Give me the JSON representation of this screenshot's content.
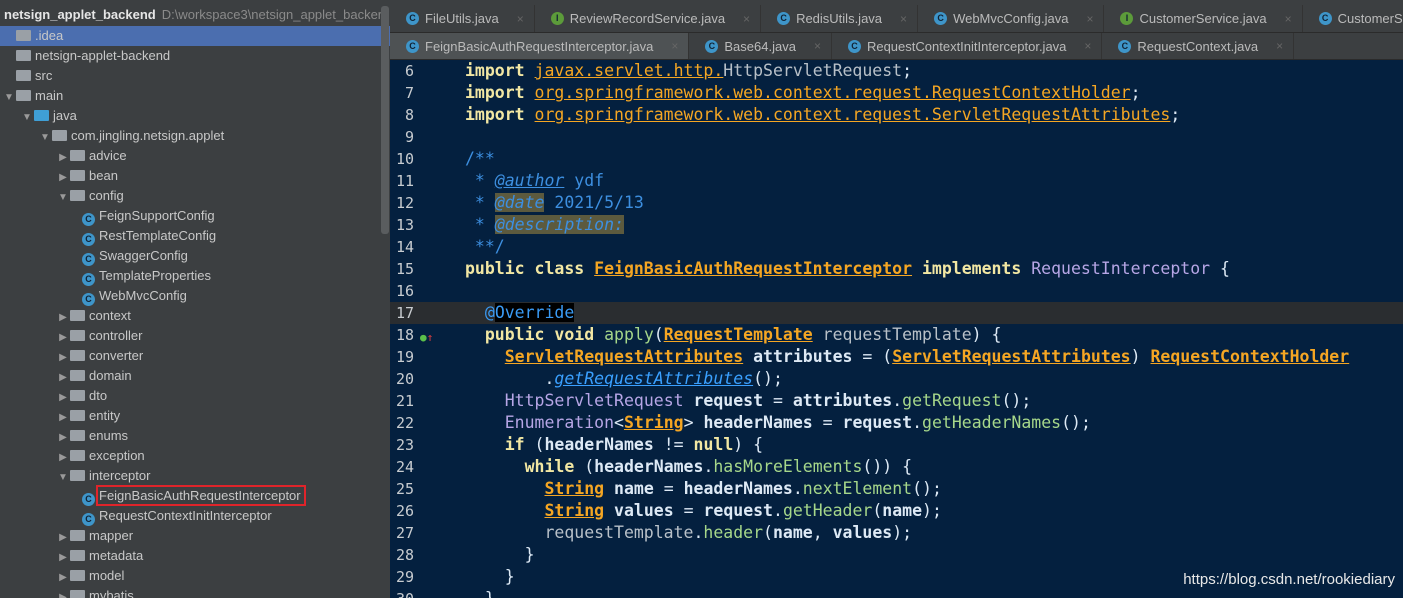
{
  "project": {
    "name": "netsign_applet_backend",
    "path": "D:\\workspace3\\netsign_applet_backer"
  },
  "tree": [
    {
      "label": ".idea",
      "level": 0,
      "kind": "folder",
      "selected": true
    },
    {
      "label": "netsign-applet-backend",
      "level": 0,
      "kind": "folder"
    },
    {
      "label": "src",
      "level": 0,
      "kind": "folder"
    },
    {
      "label": "main",
      "level": 0,
      "kind": "folder",
      "expand": "open"
    },
    {
      "label": "java",
      "level": 1,
      "kind": "src",
      "expand": "open"
    },
    {
      "label": "com.jingling.netsign.applet",
      "level": 2,
      "kind": "folder",
      "expand": "open"
    },
    {
      "label": "advice",
      "level": 3,
      "kind": "folder",
      "expand": "closed"
    },
    {
      "label": "bean",
      "level": 3,
      "kind": "folder",
      "expand": "closed"
    },
    {
      "label": "config",
      "level": 3,
      "kind": "folder",
      "expand": "open"
    },
    {
      "label": "FeignSupportConfig",
      "level": 4,
      "kind": "class"
    },
    {
      "label": "RestTemplateConfig",
      "level": 4,
      "kind": "class"
    },
    {
      "label": "SwaggerConfig",
      "level": 4,
      "kind": "class"
    },
    {
      "label": "TemplateProperties",
      "level": 4,
      "kind": "class"
    },
    {
      "label": "WebMvcConfig",
      "level": 4,
      "kind": "class"
    },
    {
      "label": "context",
      "level": 3,
      "kind": "folder",
      "expand": "closed"
    },
    {
      "label": "controller",
      "level": 3,
      "kind": "folder",
      "expand": "closed"
    },
    {
      "label": "converter",
      "level": 3,
      "kind": "folder",
      "expand": "closed"
    },
    {
      "label": "domain",
      "level": 3,
      "kind": "folder",
      "expand": "closed"
    },
    {
      "label": "dto",
      "level": 3,
      "kind": "folder",
      "expand": "closed"
    },
    {
      "label": "entity",
      "level": 3,
      "kind": "folder",
      "expand": "closed"
    },
    {
      "label": "enums",
      "level": 3,
      "kind": "folder",
      "expand": "closed"
    },
    {
      "label": "exception",
      "level": 3,
      "kind": "folder",
      "expand": "closed"
    },
    {
      "label": "interceptor",
      "level": 3,
      "kind": "folder",
      "expand": "open"
    },
    {
      "label": "FeignBasicAuthRequestInterceptor",
      "level": 4,
      "kind": "class",
      "highlighted": true
    },
    {
      "label": "RequestContextInitInterceptor",
      "level": 4,
      "kind": "class"
    },
    {
      "label": "mapper",
      "level": 3,
      "kind": "folder",
      "expand": "closed"
    },
    {
      "label": "metadata",
      "level": 3,
      "kind": "folder",
      "expand": "closed"
    },
    {
      "label": "model",
      "level": 3,
      "kind": "folder",
      "expand": "closed"
    },
    {
      "label": "mybatis",
      "level": 3,
      "kind": "folder",
      "expand": "closed"
    }
  ],
  "tabs_row1": [
    {
      "label": "FileUtils.java",
      "icon": "class"
    },
    {
      "label": "ReviewRecordService.java",
      "icon": "interface"
    },
    {
      "label": "RedisUtils.java",
      "icon": "class"
    },
    {
      "label": "WebMvcConfig.java",
      "icon": "class"
    },
    {
      "label": "CustomerService.java",
      "icon": "interface"
    },
    {
      "label": "CustomerService",
      "icon": "class"
    }
  ],
  "tabs_row2": [
    {
      "label": "FeignBasicAuthRequestInterceptor.java",
      "icon": "class",
      "active": true
    },
    {
      "label": "Base64.java",
      "icon": "class"
    },
    {
      "label": "RequestContextInitInterceptor.java",
      "icon": "class"
    },
    {
      "label": "RequestContext.java",
      "icon": "class"
    }
  ],
  "code": [
    {
      "n": "6",
      "t": [
        [
          "import ",
          "k"
        ],
        [
          "javax.servlet.http.",
          "pk"
        ],
        [
          "HttpServletRequest",
          "gr"
        ],
        [
          ";",
          "pl"
        ]
      ]
    },
    {
      "n": "7",
      "t": [
        [
          "import ",
          "k"
        ],
        [
          "org.springframework.web.context.request.RequestContextHolder",
          "pk"
        ],
        [
          ";",
          "pl"
        ]
      ]
    },
    {
      "n": "8",
      "t": [
        [
          "import ",
          "k"
        ],
        [
          "org.springframework.web.context.request.ServletRequestAttributes",
          "pk"
        ],
        [
          ";",
          "pl"
        ]
      ]
    },
    {
      "n": "9",
      "t": []
    },
    {
      "n": "10",
      "t": [
        [
          "/**",
          "cm"
        ]
      ]
    },
    {
      "n": "11",
      "t": [
        [
          " * ",
          "cm"
        ],
        [
          "@author",
          "tag"
        ],
        [
          " ydf",
          "cm"
        ]
      ]
    },
    {
      "n": "12",
      "t": [
        [
          " * ",
          "cm"
        ],
        [
          "@date",
          "tagh"
        ],
        [
          " 2021/5/13",
          "cm"
        ]
      ]
    },
    {
      "n": "13",
      "t": [
        [
          " * ",
          "cm"
        ],
        [
          "@description:",
          "tagh"
        ]
      ]
    },
    {
      "n": "14",
      "t": [
        [
          " **/",
          "cm"
        ]
      ]
    },
    {
      "n": "15",
      "t": [
        [
          "public class ",
          "k"
        ],
        [
          "FeignBasicAuthRequestInterceptor",
          "ty"
        ],
        [
          " implements ",
          "k"
        ],
        [
          "RequestInterceptor",
          "pu"
        ],
        [
          " {",
          "pl"
        ]
      ]
    },
    {
      "n": "16",
      "t": []
    },
    {
      "n": "17",
      "cur": true,
      "t": [
        [
          "  ",
          "pl"
        ],
        [
          "@",
          "an"
        ],
        [
          "Override",
          "anh"
        ]
      ]
    },
    {
      "n": "18",
      "gutter": "override",
      "t": [
        [
          "  public void ",
          "k"
        ],
        [
          "apply",
          "m"
        ],
        [
          "(",
          "pl"
        ],
        [
          "RequestTemplate",
          "ty"
        ],
        [
          " requestTemplate",
          "gr"
        ],
        [
          ") {",
          "pl"
        ]
      ]
    },
    {
      "n": "19",
      "t": [
        [
          "    ",
          "pl"
        ],
        [
          "ServletRequestAttributes",
          "ty"
        ],
        [
          " attributes",
          "id"
        ],
        [
          " = (",
          "pl"
        ],
        [
          "ServletRequestAttributes",
          "ty"
        ],
        [
          ") ",
          "pl"
        ],
        [
          "RequestContextHolder",
          "ty"
        ]
      ]
    },
    {
      "n": "20",
      "t": [
        [
          "        .",
          "pl"
        ],
        [
          "getRequestAttributes",
          "mi"
        ],
        [
          "();",
          "pl"
        ]
      ]
    },
    {
      "n": "21",
      "t": [
        [
          "    ",
          "pl"
        ],
        [
          "HttpServletRequest",
          "pu"
        ],
        [
          " request",
          "id"
        ],
        [
          " = ",
          "pl"
        ],
        [
          "attributes",
          "id"
        ],
        [
          ".",
          "pl"
        ],
        [
          "getRequest",
          "m"
        ],
        [
          "();",
          "pl"
        ]
      ]
    },
    {
      "n": "22",
      "t": [
        [
          "    ",
          "pl"
        ],
        [
          "Enumeration",
          "pu"
        ],
        [
          "<",
          "pl"
        ],
        [
          "String",
          "ty"
        ],
        [
          "> ",
          "pl"
        ],
        [
          "headerNames",
          "id"
        ],
        [
          " = ",
          "pl"
        ],
        [
          "request",
          "id"
        ],
        [
          ".",
          "pl"
        ],
        [
          "getHeaderNames",
          "m"
        ],
        [
          "();",
          "pl"
        ]
      ]
    },
    {
      "n": "23",
      "t": [
        [
          "    if ",
          "k"
        ],
        [
          "(",
          "pl"
        ],
        [
          "headerNames",
          "id"
        ],
        [
          " != ",
          "pl"
        ],
        [
          "null",
          "k"
        ],
        [
          ") {",
          "pl"
        ]
      ]
    },
    {
      "n": "24",
      "t": [
        [
          "      while ",
          "k"
        ],
        [
          "(",
          "pl"
        ],
        [
          "headerNames",
          "id"
        ],
        [
          ".",
          "pl"
        ],
        [
          "hasMoreElements",
          "m"
        ],
        [
          "()) {",
          "pl"
        ]
      ]
    },
    {
      "n": "25",
      "t": [
        [
          "        ",
          "pl"
        ],
        [
          "String",
          "ty"
        ],
        [
          " name",
          "id"
        ],
        [
          " = ",
          "pl"
        ],
        [
          "headerNames",
          "id"
        ],
        [
          ".",
          "pl"
        ],
        [
          "nextElement",
          "m"
        ],
        [
          "();",
          "pl"
        ]
      ]
    },
    {
      "n": "26",
      "t": [
        [
          "        ",
          "pl"
        ],
        [
          "String",
          "ty"
        ],
        [
          " values",
          "id"
        ],
        [
          " = ",
          "pl"
        ],
        [
          "request",
          "id"
        ],
        [
          ".",
          "pl"
        ],
        [
          "getHeader",
          "m"
        ],
        [
          "(",
          "pl"
        ],
        [
          "name",
          "id"
        ],
        [
          ");",
          "pl"
        ]
      ]
    },
    {
      "n": "27",
      "t": [
        [
          "        requestTemplate",
          "gr"
        ],
        [
          ".",
          "pl"
        ],
        [
          "header",
          "m"
        ],
        [
          "(",
          "pl"
        ],
        [
          "name",
          "id"
        ],
        [
          ", ",
          "pl"
        ],
        [
          "values",
          "id"
        ],
        [
          ");",
          "pl"
        ]
      ]
    },
    {
      "n": "28",
      "t": [
        [
          "      }",
          "pl"
        ]
      ]
    },
    {
      "n": "29",
      "t": [
        [
          "    }",
          "pl"
        ]
      ]
    },
    {
      "n": "30",
      "t": [
        [
          "  }",
          "pl"
        ]
      ]
    }
  ],
  "watermark": "https://blog.csdn.net/rookiediary"
}
